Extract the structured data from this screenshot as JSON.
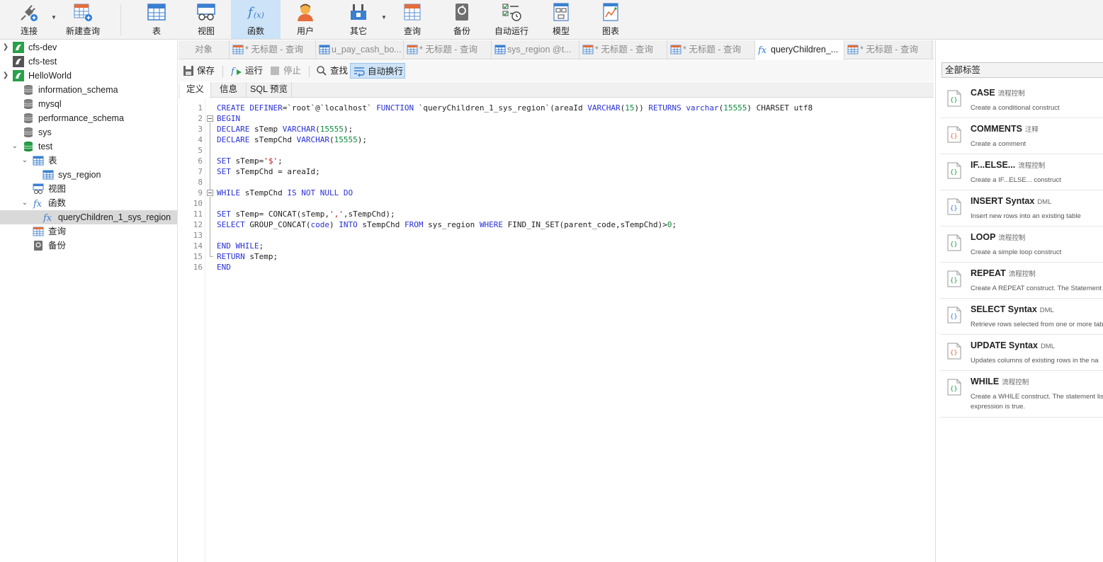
{
  "toolbar": {
    "connect": "连接",
    "new_query": "新建查询",
    "table": "表",
    "view": "视图",
    "function": "函数",
    "user": "用户",
    "other": "其它",
    "query": "查询",
    "backup": "备份",
    "automation": "自动运行",
    "model": "模型",
    "chart": "图表"
  },
  "tree": {
    "cfs_dev": "cfs-dev",
    "cfs_test": "cfs-test",
    "helloworld": "HelloWorld",
    "information_schema": "information_schema",
    "mysql": "mysql",
    "performance_schema": "performance_schema",
    "sys": "sys",
    "test": "test",
    "tables": "表",
    "sys_region": "sys_region",
    "views": "视图",
    "functions": "函数",
    "func_item": "queryChildren_1_sys_region",
    "queries": "查询",
    "backups": "备份"
  },
  "tabs": [
    "对象",
    "* 无标题 - 查询",
    "u_pay_cash_bo...",
    "* 无标题 - 查询",
    "sys_region @t...",
    "* 无标题 - 查询",
    "* 无标题 - 查询",
    "queryChildren_...",
    "* 无标题 - 查询"
  ],
  "edtools": {
    "save": "保存",
    "run": "运行",
    "stop": "停止",
    "find": "查找",
    "wrap": "自动换行"
  },
  "subtabs": {
    "definition": "定义",
    "info": "信息",
    "sql_preview": "SQL 预览"
  },
  "code": {
    "line_numbers": [
      "1",
      "2",
      "3",
      "4",
      "5",
      "6",
      "7",
      "8",
      "9",
      "10",
      "11",
      "12",
      "13",
      "14",
      "15",
      "16"
    ]
  },
  "snippets": {
    "filter": "全部标签",
    "items": [
      {
        "name": "CASE",
        "tag": "流程控制",
        "desc": "Create a conditional construct"
      },
      {
        "name": "COMMENTS",
        "tag": "注释",
        "desc": "Create a comment"
      },
      {
        "name": "IF...ELSE...",
        "tag": "流程控制",
        "desc": "Create a IF...ELSE... construct"
      },
      {
        "name": "INSERT Syntax",
        "tag": "DML",
        "desc": "Insert new rows into an existing table"
      },
      {
        "name": "LOOP",
        "tag": "流程控制",
        "desc": "Create a simple loop construct"
      },
      {
        "name": "REPEAT",
        "tag": "流程控制",
        "desc": "Create A REPEAT construct. The Statement l"
      },
      {
        "name": "SELECT Syntax",
        "tag": "DML",
        "desc": "Retrieve rows selected from one or more tab"
      },
      {
        "name": "UPDATE Syntax",
        "tag": "DML",
        "desc": "Updates columns of existing rows in the na"
      },
      {
        "name": "WHILE",
        "tag": "流程控制",
        "desc": "Create a WHILE construct. The statement lis expression is true."
      }
    ]
  },
  "colors": {
    "keyword": "#2a31d4",
    "number": "#0d8a3a",
    "string": "#c21a1a",
    "active_toolbar": "#cde3f7"
  }
}
